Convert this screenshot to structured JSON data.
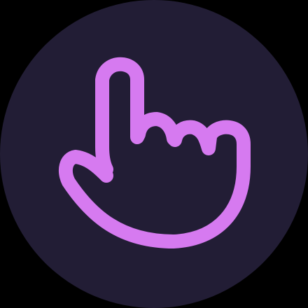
{
  "app_icon": {
    "icon_name": "pointing-hand-icon",
    "background_color": "#221d35",
    "glyph_color": "#d67af0",
    "page_background": "#000000"
  }
}
